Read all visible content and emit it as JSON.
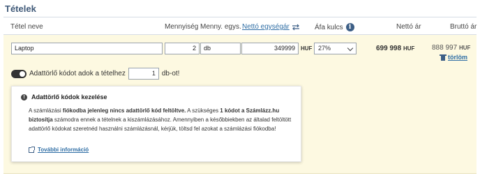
{
  "section": {
    "title": "Tételek"
  },
  "columns": {
    "name": "Tétel neve",
    "quantity": "Mennyiség",
    "unit": "Menny. egys.",
    "net_unit_price": "Nettó egységár",
    "vat_rate": "Áfa kulcs",
    "net_price": "Nettó ár",
    "gross_price": "Bruttó ár"
  },
  "item": {
    "name": "Laptop",
    "quantity": "2",
    "unit": "db",
    "net_unit_price": "349999",
    "currency": "HUF",
    "vat_rate": "27%",
    "net_total": "699 998",
    "gross_total": "888 997",
    "delete_label": "törlöm"
  },
  "toggle": {
    "enabled": true,
    "label_before": "Adattörlő kódot adok a tételhez",
    "count": "1",
    "label_after": "db-ot!"
  },
  "notice": {
    "title": "Adattörlő kódok kezelése",
    "body_1": "A számlázási ",
    "body_2_bold": "fiókodba jelenleg nincs adattörlő kód feltöltve.",
    "body_3": " A szükséges ",
    "body_4_bold": "1 kódot a Számlázz.hu biztosítja",
    "body_5": " számodra ennek a tételnek a kiszámlázásához. Amennyiben a későbbiekben az általad feltöltött adattörlő kódokat szeretnéd használni számlázásnál, kérjük, töltsd fel azokat a számlázási fiókodba!",
    "more_link": "További információ"
  },
  "icons": {
    "vat_info": "info-icon",
    "price_toggle": "swap-icon",
    "delete": "trash-icon",
    "notice": "exclamation-icon",
    "more": "external-link-icon"
  },
  "colors": {
    "panel_bg": "#fdf9e1",
    "link": "#2e6da4",
    "title": "#3f5978"
  }
}
